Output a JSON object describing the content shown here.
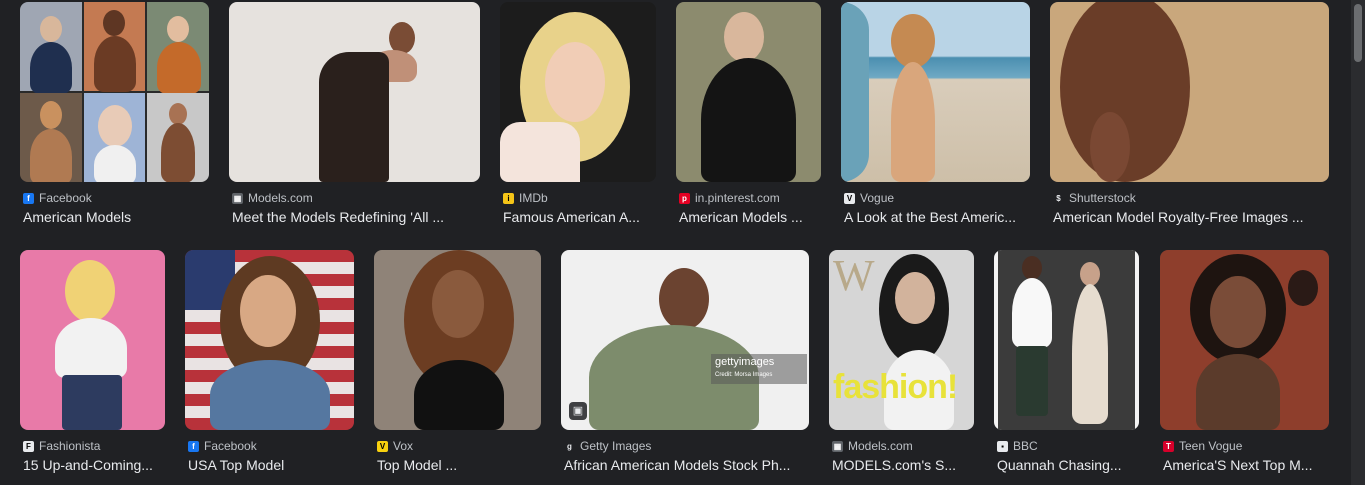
{
  "results": [
    {
      "source": "Facebook",
      "title": "American Models",
      "favicon_color": "#1877f2",
      "favicon_glyph": "f"
    },
    {
      "source": "Models.com",
      "title": "Meet the Models Redefining 'All ...",
      "favicon_color": "#5f6368",
      "favicon_glyph": "▦"
    },
    {
      "source": "IMDb",
      "title": "Famous American A...",
      "favicon_color": "#f5c518",
      "favicon_glyph": "i"
    },
    {
      "source": "in.pinterest.com",
      "title": "American Models ...",
      "favicon_color": "#e60023",
      "favicon_glyph": "p"
    },
    {
      "source": "Vogue",
      "title": "A Look at the Best Americ...",
      "favicon_color": "#e8eaed",
      "favicon_glyph": "V"
    },
    {
      "source": "Shutterstock",
      "title": "American Model Royalty-Free Images ...",
      "favicon_color": "#202124",
      "favicon_glyph": "$"
    },
    {
      "source": "Fashionista",
      "title": "15 Up-and-Coming...",
      "favicon_color": "#e8eaed",
      "favicon_glyph": "F"
    },
    {
      "source": "Facebook",
      "title": "USA Top Model",
      "favicon_color": "#1877f2",
      "favicon_glyph": "f"
    },
    {
      "source": "Vox",
      "title": "Top Model ...",
      "favicon_color": "#f8d10f",
      "favicon_glyph": "V"
    },
    {
      "source": "Getty Images",
      "title": "African American Models Stock Ph...",
      "favicon_color": "#202124",
      "favicon_glyph": "g"
    },
    {
      "source": "Models.com",
      "title": "MODELS.com's S...",
      "favicon_color": "#5f6368",
      "favicon_glyph": "▦"
    },
    {
      "source": "BBC",
      "title": "Quannah Chasing...",
      "favicon_color": "#e8eaed",
      "favicon_glyph": "▪"
    },
    {
      "source": "Teen Vogue",
      "title": "America'S Next Top M...",
      "favicon_color": "#d6002a",
      "favicon_glyph": "T"
    }
  ],
  "overlays": {
    "getty_watermark": "gettyimages",
    "getty_credit": "Credit: Morsa Images",
    "magazine_masthead": "W",
    "magazine_cover_text": "fashion!"
  }
}
